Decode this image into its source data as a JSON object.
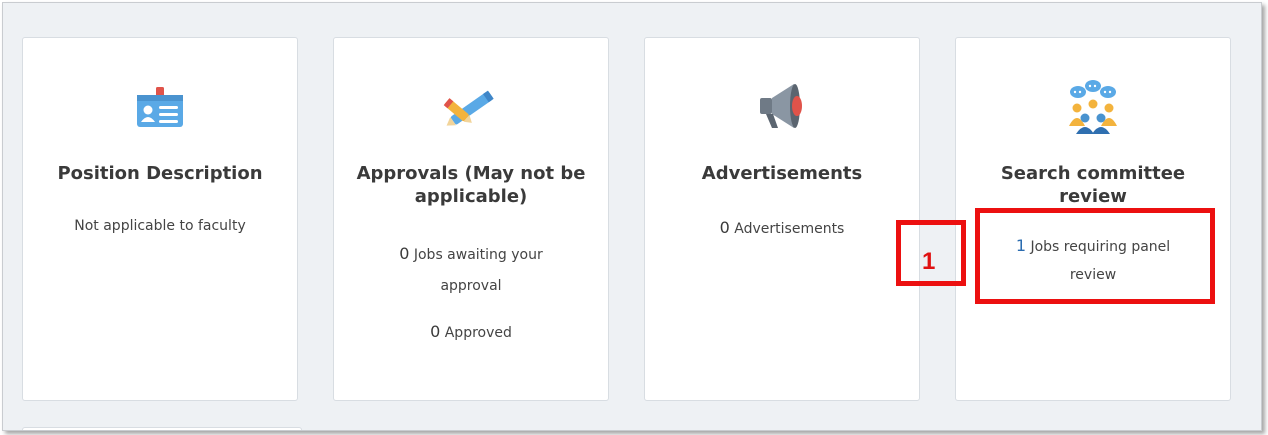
{
  "cards": [
    {
      "title": "Position Description",
      "icon": "id-badge-icon",
      "text": "Not applicable to faculty"
    },
    {
      "title": "Approvals (May not be applicable)",
      "icon": "check-pencil-icon",
      "awaiting_count": "0",
      "awaiting_label_1": "Jobs awaiting your",
      "awaiting_label_2": "approval",
      "approved_count": "0",
      "approved_label": "Approved"
    },
    {
      "title": "Advertisements",
      "icon": "megaphone-icon",
      "count": "0",
      "label": "Advertisements"
    },
    {
      "title": "Search committee review",
      "icon": "committee-group-icon",
      "count": "1",
      "label_1": "Jobs requiring panel",
      "label_2": "review"
    }
  ],
  "annotation": {
    "marker": "1",
    "color": "#ec1010"
  },
  "colors": {
    "link_blue": "#2b6cb0",
    "background": "#eef1f4"
  }
}
